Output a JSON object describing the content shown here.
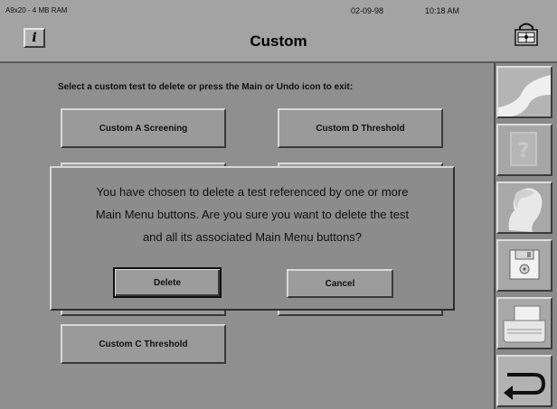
{
  "header": {
    "system_info": "A9x20 - 4 MB RAM",
    "date": "02-09-98",
    "time": "10:18 AM",
    "title": "Custom",
    "info_glyph": "i"
  },
  "instruction": "Select a custom test to delete or press the Main or Undo icon to exit:",
  "tests": [
    {
      "label": "Custom A Screening"
    },
    {
      "label": "Custom D Threshold"
    },
    {
      "label": "Custom C Threshold"
    }
  ],
  "dialog": {
    "lines": [
      "You have chosen to delete a test referenced by one or more",
      "Main Menu buttons. Are you sure you want to delete the test",
      "and all its associated Main Menu buttons?"
    ],
    "delete_label": "Delete",
    "cancel_label": "Cancel"
  },
  "toolbar": {
    "icons": [
      "main-curve-icon",
      "help-question-icon",
      "patient-profile-icon",
      "save-disk-icon",
      "printer-icon",
      "undo-arrow-icon"
    ]
  },
  "colors": {
    "background": "#8f8f8f",
    "panel": "#a3a3a3",
    "button_face": "#9a9a9a"
  }
}
